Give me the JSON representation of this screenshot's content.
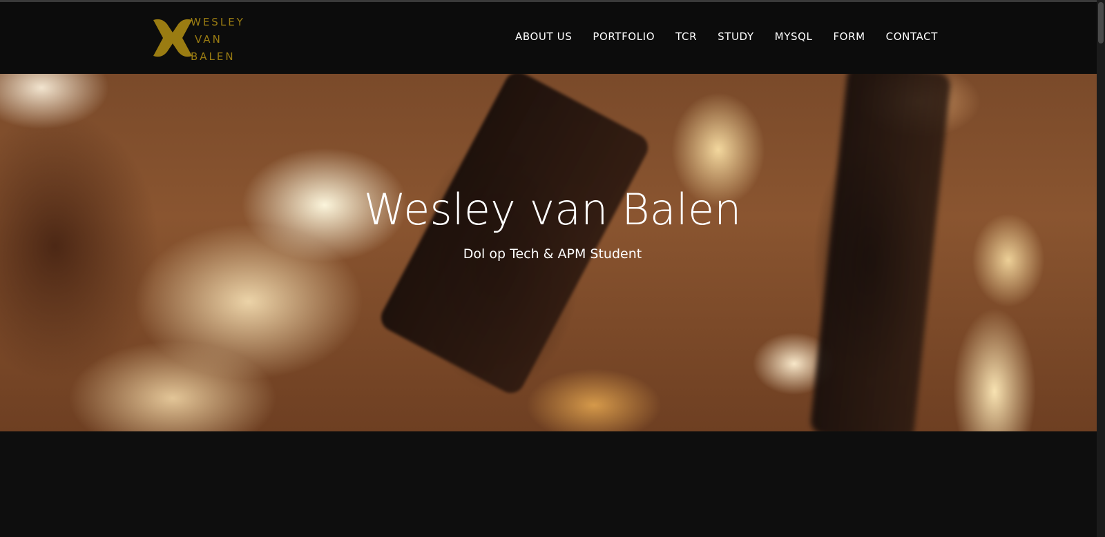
{
  "logo": {
    "lines": [
      "WESLEY",
      "VAN",
      "BALEN"
    ],
    "color": "#9a7c12"
  },
  "nav": {
    "items": [
      {
        "label": "ABOUT US"
      },
      {
        "label": "PORTFOLIO"
      },
      {
        "label": "TCR"
      },
      {
        "label": "STUDY"
      },
      {
        "label": "MYSQL"
      },
      {
        "label": "FORM"
      },
      {
        "label": "CONTACT"
      }
    ]
  },
  "hero": {
    "title": "Wesley van Balen",
    "subtitle": "Dol op Tech & APM Student",
    "background": "fire"
  },
  "colors": {
    "background": "#0e0e0e",
    "navbar": "#0c0c0c",
    "text": "#ffffff",
    "accent": "#9a7c12"
  }
}
